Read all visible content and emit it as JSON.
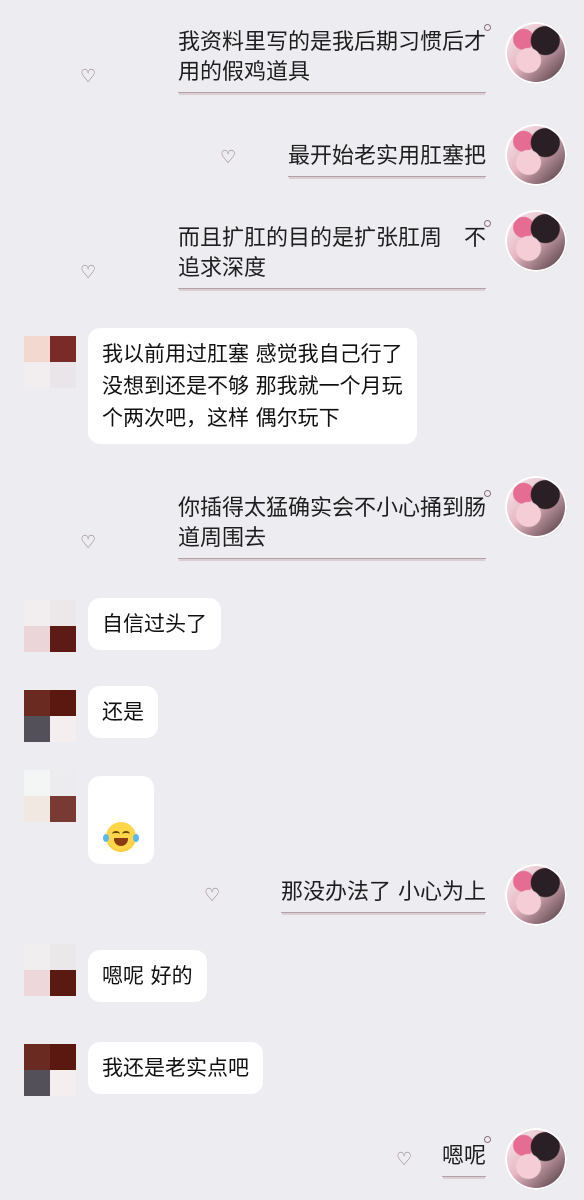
{
  "messages": [
    {
      "dir": "out",
      "text": "我资料里写的是我后期习惯后才\n用的假鸡道具"
    },
    {
      "dir": "out",
      "text": "最开始老实用肛塞把"
    },
    {
      "dir": "out",
      "text": "而且扩肛的目的是扩张肛周　不\n追求深度"
    },
    {
      "dir": "in",
      "text": "我以前用过肛塞  感觉我自己行了\n没想到还是不够 那我就一个月玩\n个两次吧，这样 偶尔玩下"
    },
    {
      "dir": "out",
      "text": "你插得太猛确实会不小心捅到肠\n道周围去"
    },
    {
      "dir": "in",
      "text": "自信过头了"
    },
    {
      "dir": "in",
      "text": "还是"
    },
    {
      "dir": "in",
      "emoji": "joy-tears-emoji"
    },
    {
      "dir": "out",
      "text": "那没办法了  小心为上"
    },
    {
      "dir": "in",
      "text": "嗯呢  好的"
    },
    {
      "dir": "in",
      "text": "我还是老实点吧"
    },
    {
      "dir": "out",
      "text": "嗯呢"
    }
  ],
  "icons": {
    "heart": "heart-outline-icon",
    "dot": "small-circle-icon"
  },
  "colors": {
    "background": "#ececf1",
    "bubble": "#ffffff",
    "underline": "#b3a1a6"
  }
}
